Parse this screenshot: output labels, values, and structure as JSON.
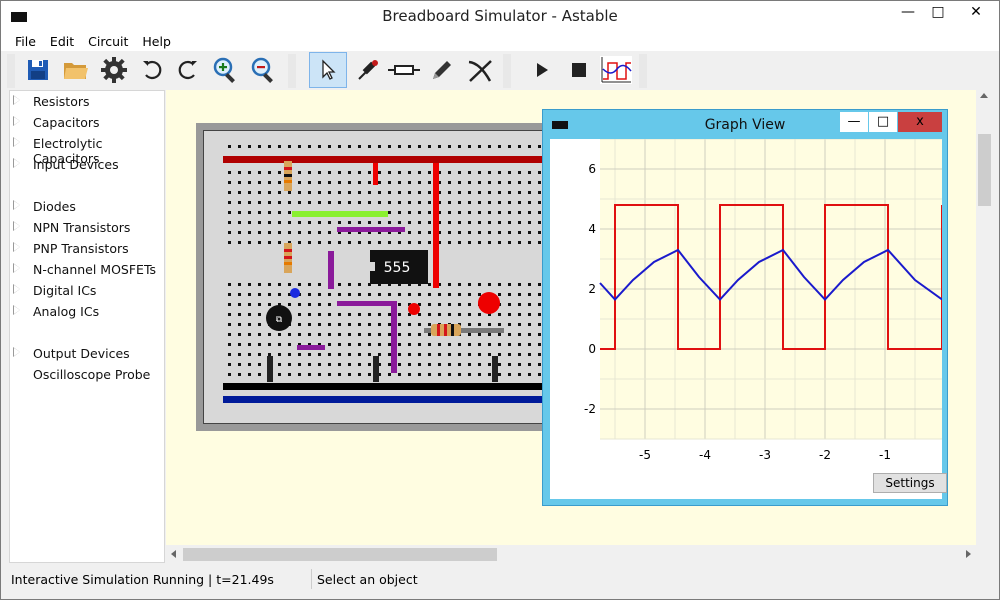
{
  "window": {
    "title": "Breadboard Simulator - Astable",
    "minimize": "—",
    "maximize": "□",
    "close": "✕"
  },
  "menu": [
    "File",
    "Edit",
    "Circuit",
    "Help"
  ],
  "toolbar": {
    "buttons": [
      "save-icon",
      "open-folder-icon",
      "settings-gear-icon",
      "undo-icon",
      "redo-icon",
      "zoom-in-icon",
      "zoom-out-icon",
      "select-pointer-icon",
      "probe-icon",
      "resistor-icon",
      "pencil-icon",
      "cut-wire-icon",
      "run-icon",
      "stop-icon",
      "graph-icon"
    ],
    "selected": "select-pointer-icon"
  },
  "sidebar": {
    "groups": [
      {
        "label": "Resistors",
        "expandable": true
      },
      {
        "label": "Capacitors",
        "expandable": true
      },
      {
        "label": "Electrolytic Capacitors",
        "expandable": true
      },
      {
        "label": "Input Devices",
        "expandable": true
      },
      {
        "label": "Diodes",
        "expandable": true
      },
      {
        "label": "NPN Transistors",
        "expandable": true
      },
      {
        "label": "PNP Transistors",
        "expandable": true
      },
      {
        "label": "N-channel MOSFETs",
        "expandable": true
      },
      {
        "label": "Digital ICs",
        "expandable": true
      },
      {
        "label": "Analog ICs",
        "expandable": true
      },
      {
        "label": "Output Devices",
        "expandable": true
      },
      {
        "label": "Oscilloscope Probe",
        "expandable": false
      }
    ]
  },
  "breadboard": {
    "ic_label": "555"
  },
  "graph_view": {
    "title": "Graph View",
    "minimize": "—",
    "maximize": "□",
    "close": "x",
    "settings_label": "Settings"
  },
  "chart_data": {
    "type": "line",
    "x_ticks": [
      -5,
      -4,
      -3,
      -2,
      -1
    ],
    "y_ticks": [
      6,
      4,
      2,
      0,
      -2
    ],
    "xlim": [
      -5.75,
      -0.05
    ],
    "ylim": [
      -3,
      7
    ],
    "grid": true,
    "series": [
      {
        "color": "#e01010",
        "points": [
          [
            -5.75,
            0
          ],
          [
            -5.5,
            0
          ],
          [
            -5.5,
            4.8
          ],
          [
            -4.45,
            4.8
          ],
          [
            -4.45,
            0
          ],
          [
            -3.75,
            0
          ],
          [
            -3.75,
            4.8
          ],
          [
            -2.7,
            4.8
          ],
          [
            -2.7,
            0
          ],
          [
            -2.0,
            0
          ],
          [
            -2.0,
            4.8
          ],
          [
            -0.95,
            4.8
          ],
          [
            -0.95,
            0
          ],
          [
            -0.05,
            0
          ],
          [
            -0.05,
            4.8
          ]
        ]
      },
      {
        "color": "#1a1acc",
        "points": [
          [
            -5.75,
            2.2
          ],
          [
            -5.5,
            1.65
          ],
          [
            -5.2,
            2.3
          ],
          [
            -4.85,
            2.9
          ],
          [
            -4.45,
            3.3
          ],
          [
            -4.1,
            2.4
          ],
          [
            -3.75,
            1.65
          ],
          [
            -3.45,
            2.3
          ],
          [
            -3.1,
            2.9
          ],
          [
            -2.7,
            3.3
          ],
          [
            -2.35,
            2.4
          ],
          [
            -2.0,
            1.65
          ],
          [
            -1.7,
            2.3
          ],
          [
            -1.35,
            2.9
          ],
          [
            -0.95,
            3.3
          ],
          [
            -0.5,
            2.3
          ],
          [
            -0.05,
            1.65
          ]
        ]
      }
    ]
  },
  "status": {
    "left": "Interactive Simulation Running | t=21.49s",
    "right": "Select an object"
  }
}
